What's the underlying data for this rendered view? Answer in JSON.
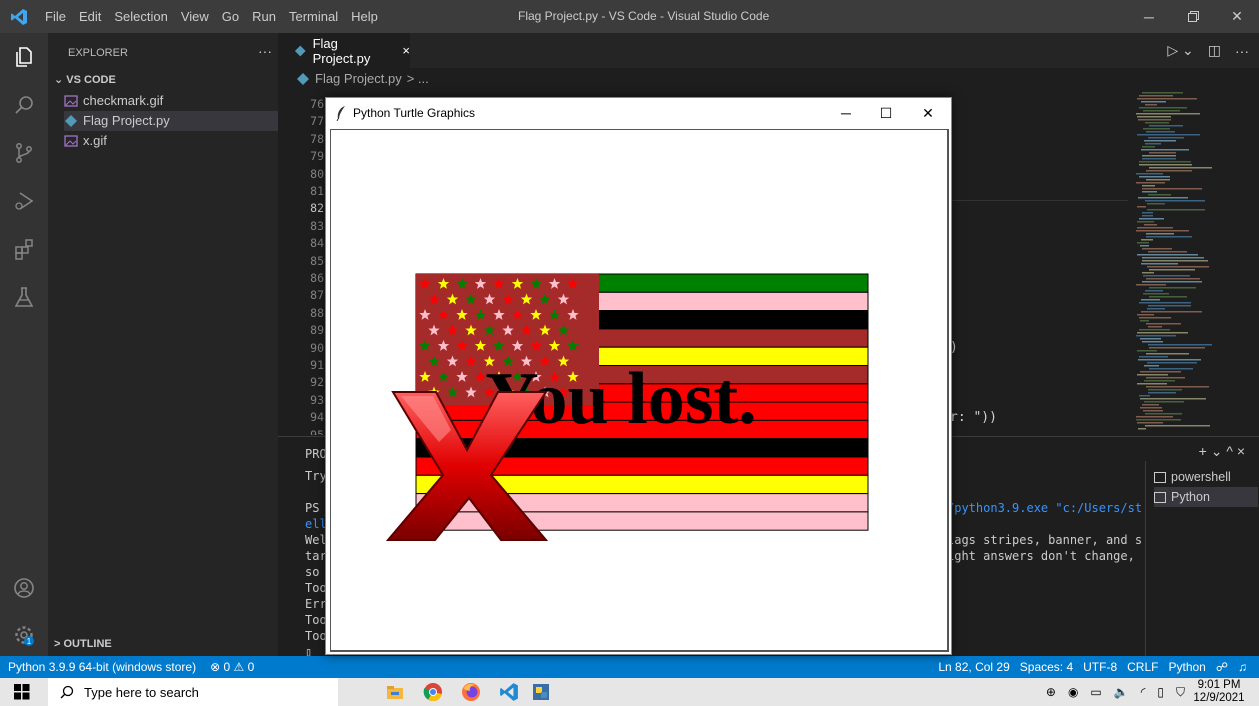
{
  "window": {
    "title": "Flag Project.py - VS Code - Visual Studio Code",
    "menu": [
      "File",
      "Edit",
      "Selection",
      "View",
      "Go",
      "Run",
      "Terminal",
      "Help"
    ]
  },
  "sidebar": {
    "header": "EXPLORER",
    "more": "···",
    "section": "VS CODE",
    "files": [
      {
        "name": "checkmark.gif",
        "icon": "image-file-icon"
      },
      {
        "name": "Flag Project.py",
        "icon": "python-file-icon"
      },
      {
        "name": "x.gif",
        "icon": "image-file-icon"
      }
    ],
    "outline": "OUTLINE"
  },
  "editor": {
    "tab_label": "Flag Project.py",
    "tab_close": "×",
    "breadcrumb_file": "Flag Project.py",
    "breadcrumb_rest": "> ...",
    "line_numbers": [
      "76",
      "77",
      "78",
      "79",
      "80",
      "81",
      "82",
      "83",
      "84",
      "85",
      "86",
      "87",
      "88",
      "89",
      "90",
      "91",
      "92",
      "93",
      "94",
      "95"
    ],
    "current_line": "82",
    "visible_code_fragments": [
      ")",
      "r: \"))"
    ]
  },
  "panel": {
    "tab_fragment": "PRO",
    "left_lines": [
      "Try",
      "",
      "PS C",
      "ella",
      "Welc",
      "tars",
      "so c",
      "Too ",
      "Erro",
      "Too ",
      "Too ",
      "▯"
    ],
    "right_lines": [
      {
        "text": "/python3.9.exe \"c:/Users/st",
        "kind": "cmd"
      },
      {
        "text": "lags stripes, banner, and s",
        "kind": "text"
      },
      {
        "text": "ight answers don't change,",
        "kind": "text"
      }
    ],
    "terminals": [
      "powershell",
      "Python"
    ],
    "controls": "+ ⌄ ^ ×"
  },
  "statusbar": {
    "interpreter": "Python 3.9.9 64-bit (windows store)",
    "problems": "⊗ 0 ⚠ 0",
    "position": "Ln 82, Col 29",
    "spaces": "Spaces: 4",
    "encoding": "UTF-8",
    "eol": "CRLF",
    "language": "Python"
  },
  "taskbar": {
    "search_placeholder": "Type here to search",
    "time": "9:01 PM",
    "date": "12/9/2021"
  },
  "turtle": {
    "title": "Python Turtle Graphics",
    "message": "You lost.",
    "stripe_colors": [
      "#008000",
      "#ffc0cb",
      "#000000",
      "#a52a2a",
      "#ffff00",
      "#a52a2a",
      "#ff0000",
      "#ff0000",
      "#ff0000",
      "#000000",
      "#ff0000",
      "#ffff00",
      "#ffc0cb",
      "#ffc0cb"
    ],
    "canton_color": "#a52a2a",
    "star_colors": [
      "#ff0000",
      "#ffc0cb",
      "#008000",
      "#ffff00"
    ]
  }
}
